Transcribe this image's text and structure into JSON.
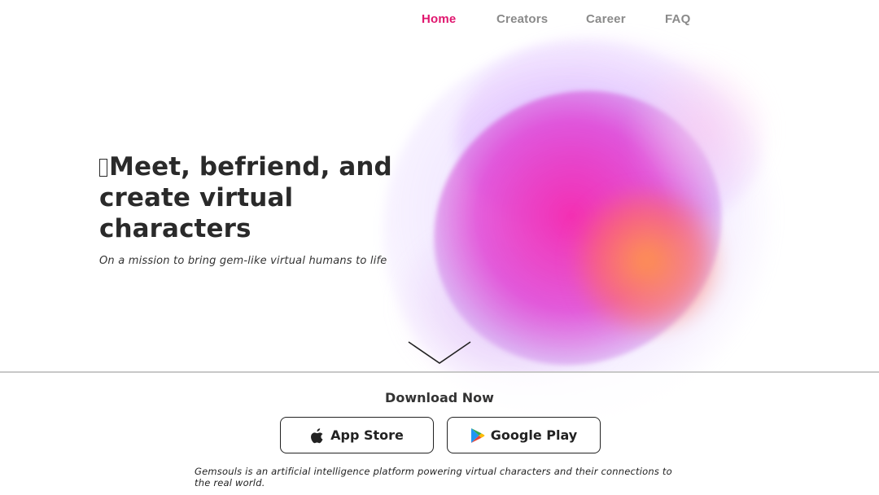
{
  "nav": {
    "items": [
      {
        "label": "Home",
        "active": true
      },
      {
        "label": "Creators",
        "active": false
      },
      {
        "label": "Career",
        "active": false
      },
      {
        "label": "FAQ",
        "active": false
      }
    ],
    "active_color": "#e0166e",
    "inactive_color": "#8a8a8a"
  },
  "hero": {
    "title_line1": "Meet, befriend, and",
    "title_line2": "create virtual characters",
    "subtitle": "On a mission to bring gem-like virtual humans to life"
  },
  "scroll_indicator": {
    "icon": "chevron-down-icon"
  },
  "download": {
    "title": "Download Now",
    "buttons": [
      {
        "label": "App Store",
        "icon": "apple-icon"
      },
      {
        "label": "Google Play",
        "icon": "google-play-icon"
      }
    ]
  },
  "footer": {
    "description": "Gemsouls is an artificial intelligence platform powering virtual characters and their connections to the real world."
  },
  "colors": {
    "accent": "#e0166e",
    "text": "#2a2a2a",
    "blob_pink": "#f528af",
    "blob_orange": "#ff9646",
    "blob_lavender": "#be96ff"
  }
}
